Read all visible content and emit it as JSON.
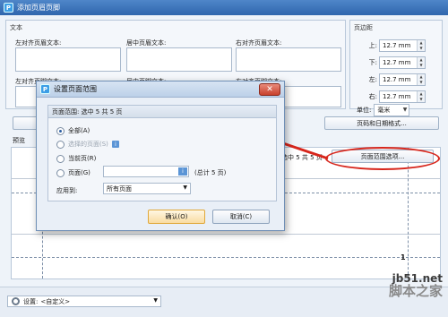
{
  "window": {
    "title": "添加页眉页脚"
  },
  "header_group": {
    "label": "文本",
    "left_header_label": "左对齐页眉文本:",
    "center_header_label": "居中页眉文本:",
    "right_header_label": "右对齐页眉文本:",
    "left_footer_label": "左对齐页脚文本:",
    "center_footer_label": "居中页脚文本:",
    "right_footer_label": "右对齐页脚文本:"
  },
  "margins": {
    "label": "页边距",
    "top_label": "上:",
    "top_value": "12.7 mm",
    "bottom_label": "下:",
    "bottom_value": "12.7 mm",
    "left_label": "左:",
    "left_value": "12.7 mm",
    "right_label": "右:",
    "right_value": "12.7 mm",
    "unit_label": "单位:",
    "unit_value": "毫米"
  },
  "buttons": {
    "page_number_format": "页码和日期格式...",
    "page_range_options": "页面范围选项..."
  },
  "preview": {
    "label": "预览",
    "info": "选中 5 共 5 页",
    "page_number": "1"
  },
  "settings": {
    "label": "设置:",
    "value": "<自定义>"
  },
  "watermark": {
    "line1": "jb51.net",
    "line2": "脚本之家"
  },
  "dialog": {
    "title": "设置页面范围",
    "close_symbol": "✕",
    "range_header": "页面范围: 选中 5 共 5 页",
    "options": {
      "all": "全部(A)",
      "selected": "选择的页面(S)",
      "current": "当前页(R)",
      "pages": "页面(G)"
    },
    "total": "(总计 5 页)",
    "apply_label": "应用到:",
    "apply_value": "所有页面",
    "ok": "确认(O)",
    "cancel": "取消(C)"
  },
  "icons": {
    "info": "i",
    "dropdown": "▼",
    "app": "P"
  },
  "colors": {
    "highlight": "#d7261c",
    "accent": "#2f66ad"
  }
}
